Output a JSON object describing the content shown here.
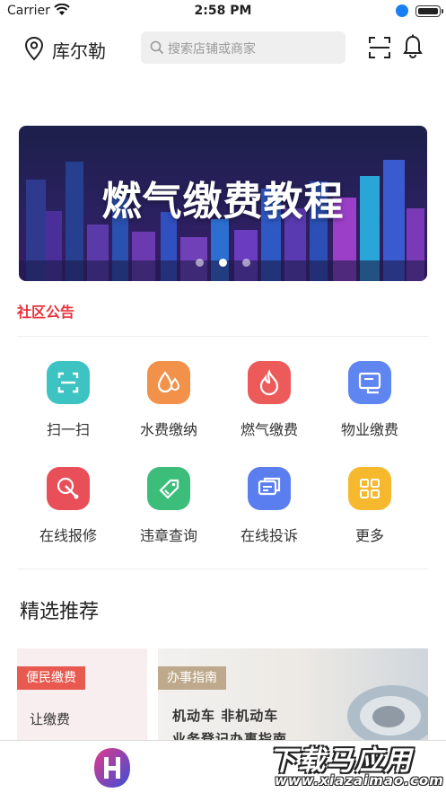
{
  "status_bar": {
    "carrier": "Carrier",
    "time": "2:58 PM"
  },
  "header": {
    "city": "库尔勒",
    "search_placeholder": "搜索店铺或商家",
    "icons": [
      "location-pin-icon",
      "scan-icon",
      "bell-icon"
    ]
  },
  "banner": {
    "title": "燃气缴费教程",
    "page_count": 3,
    "active_page": 2
  },
  "notice": {
    "label": "社区公告",
    "color": "#e8323c"
  },
  "services": [
    {
      "label": "扫一扫",
      "icon": "scan-icon",
      "color": "#3ec3c3"
    },
    {
      "label": "水费缴纳",
      "icon": "water-drop-icon",
      "color": "#f2914a"
    },
    {
      "label": "燃气缴费",
      "icon": "flame-icon",
      "color": "#ec5a5a"
    },
    {
      "label": "物业缴费",
      "icon": "property-icon",
      "color": "#5f86f0"
    },
    {
      "label": "在线报修",
      "icon": "repair-icon",
      "color": "#e84f58"
    },
    {
      "label": "违章查询",
      "icon": "violation-icon",
      "color": "#3dbd7a"
    },
    {
      "label": "在线投诉",
      "icon": "complaint-icon",
      "color": "#5a7ef0"
    },
    {
      "label": "更多",
      "icon": "more-grid-icon",
      "color": "#f6b92e"
    }
  ],
  "recommend": {
    "title": "精选推荐",
    "cards": [
      {
        "tag": "便民缴费",
        "line1": "让缴费",
        "line2": ""
      },
      {
        "tag": "办事指南",
        "line1": "机动车 非机动车",
        "line2": "业务登记办事指南"
      }
    ]
  },
  "watermark": {
    "big": "下载马应用",
    "small": "www.xiazaimao.com"
  }
}
